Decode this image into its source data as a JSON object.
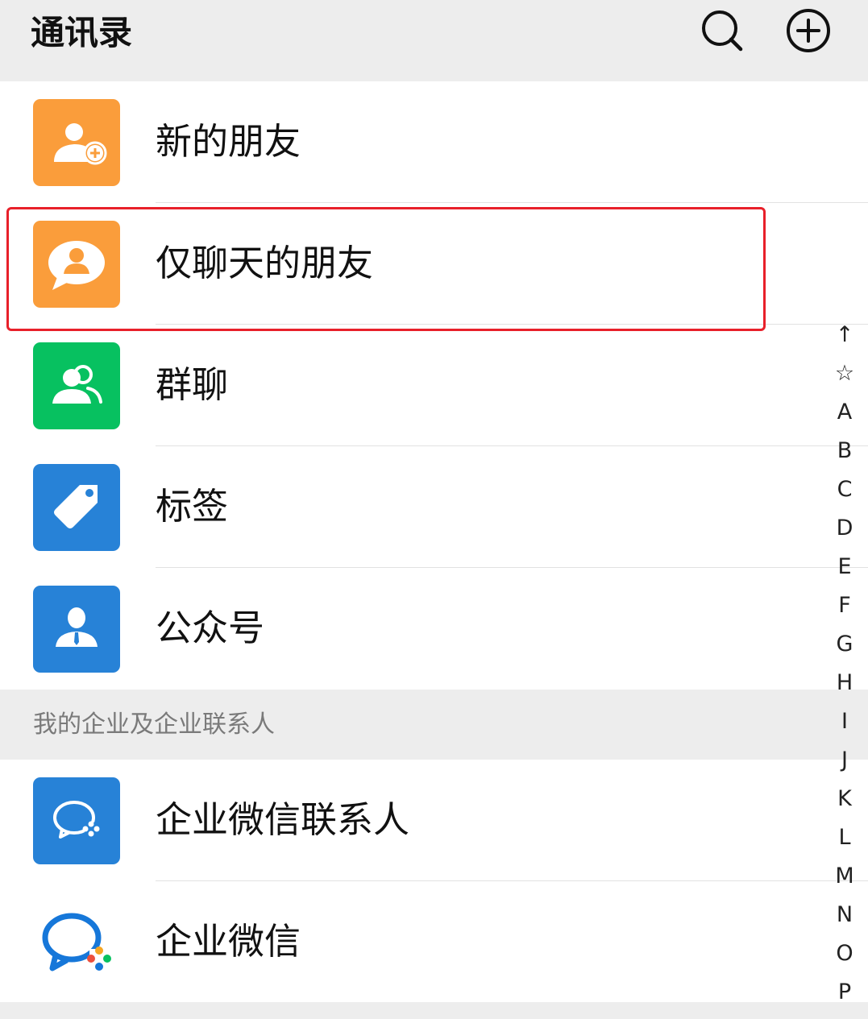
{
  "header": {
    "title": "通讯录",
    "search_icon": "search-icon",
    "add_icon": "plus-circle-icon"
  },
  "top_items": [
    {
      "label": "新的朋友",
      "icon": "add-friend-icon",
      "color": "#fa9d3b"
    },
    {
      "label": "仅聊天的朋友",
      "icon": "chat-only-friend-icon",
      "color": "#fa9d3b"
    },
    {
      "label": "群聊",
      "icon": "group-chat-icon",
      "color": "#07c160"
    },
    {
      "label": "标签",
      "icon": "tag-icon",
      "color": "#2782d7"
    },
    {
      "label": "公众号",
      "icon": "official-account-icon",
      "color": "#2782d7"
    }
  ],
  "section": {
    "title": "我的企业及企业联系人"
  },
  "bottom_items": [
    {
      "label": "企业微信联系人",
      "icon": "wecom-contacts-icon",
      "color": "#2782d7"
    },
    {
      "label": "企业微信",
      "icon": "wecom-logo-icon"
    }
  ],
  "index": [
    "↑",
    "☆",
    "A",
    "B",
    "C",
    "D",
    "E",
    "F",
    "G",
    "H",
    "I",
    "J",
    "K",
    "L",
    "M",
    "N",
    "O",
    "P"
  ],
  "highlight_color": "#e8202a"
}
